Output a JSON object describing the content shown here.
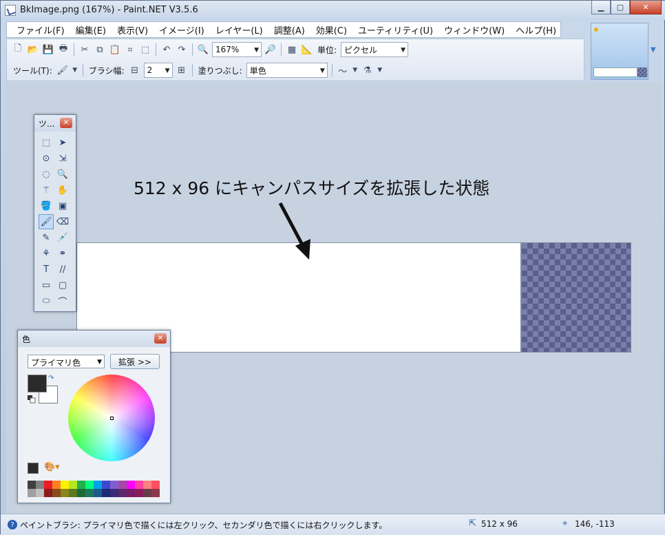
{
  "window": {
    "title": "BkImage.png (167%) - Paint.NET V3.5.6"
  },
  "menu": [
    "ファイル(F)",
    "編集(E)",
    "表示(V)",
    "イメージ(I)",
    "レイヤー(L)",
    "調整(A)",
    "効果(C)",
    "ユーティリティ(U)",
    "ウィンドウ(W)",
    "ヘルプ(H)"
  ],
  "toolbar": {
    "zoom": "167%",
    "unit_label": "単位:",
    "unit_value": "ピクセル",
    "tool_label": "ツール(T):",
    "brush_width_label": "ブラシ幅:",
    "brush_width_value": "2",
    "fill_label": "塗りつぶし:",
    "fill_value": "単色"
  },
  "canvas": {
    "annotation": "512 x 96 にキャンパスサイズを拡張した状態"
  },
  "tools_window": {
    "title": "ツ..."
  },
  "colors_window": {
    "title": "色",
    "selected": "プライマリ色",
    "expand_button": "拡張 >>"
  },
  "status": {
    "help_text": "ペイントブラシ: プライマリ色で描くには左クリック、セカンダリ色で描くには右クリックします。",
    "image_size": "512 x 96",
    "cursor_pos": "146, -113"
  },
  "palette_colors": [
    "#404040",
    "#808080",
    "#ed1c24",
    "#ff7f27",
    "#fff200",
    "#b5e61d",
    "#22b14c",
    "#00ff80",
    "#00a2e8",
    "#3f48cc",
    "#7f5fd0",
    "#a349a4",
    "#ff00ff",
    "#ff40a0",
    "#ff8080",
    "#ff5060",
    "#a0a0a0",
    "#c0c0c0",
    "#8a1c1c",
    "#8a4a1c",
    "#8a861c",
    "#5a7a1c",
    "#1c6a3a",
    "#1c7a5a",
    "#1c5a8a",
    "#1c2a7a",
    "#3a2a7a",
    "#5a2a6a",
    "#7a1c6a",
    "#8a1c5a",
    "#6a3a4a",
    "#8a3a4a"
  ]
}
